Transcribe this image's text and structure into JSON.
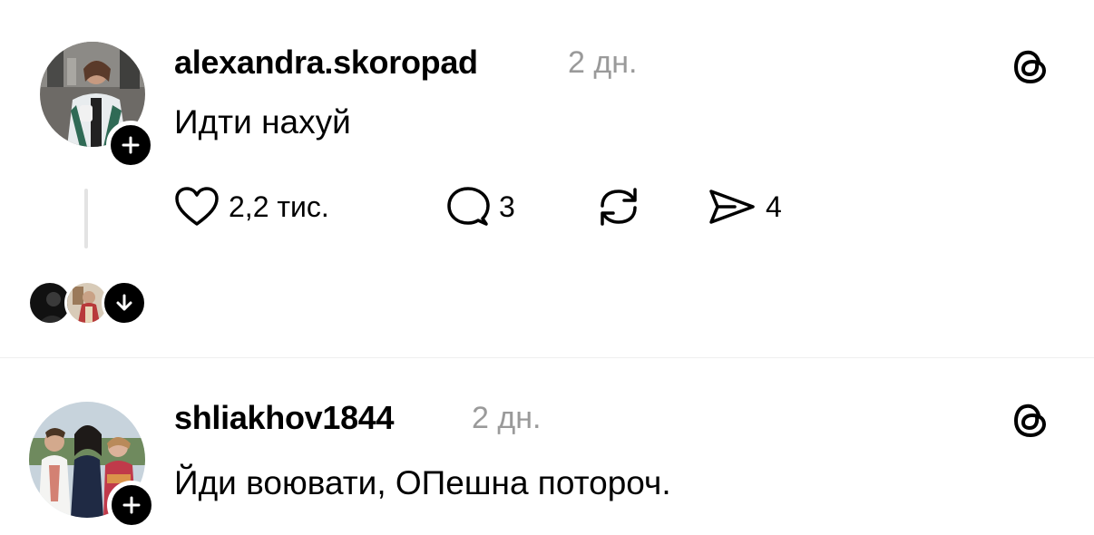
{
  "posts": [
    {
      "username": "alexandra.skoropad",
      "time": "2 дн.",
      "text": "Идти нахуй",
      "likes": "2,2 тис.",
      "replies": "3",
      "shares": "4"
    },
    {
      "username": "shliakhov1844",
      "time": "2 дн.",
      "text": "Йди воювати, ОПешна потороч."
    }
  ],
  "icons": {
    "like": "heart-icon",
    "reply": "comment-icon",
    "repost": "repost-icon",
    "share": "send-icon",
    "platform": "threads-icon",
    "follow": "plus-icon",
    "expand": "arrow-down-icon"
  },
  "colors": {
    "text": "#000000",
    "muted": "#9a9a9a",
    "background": "#ffffff"
  }
}
